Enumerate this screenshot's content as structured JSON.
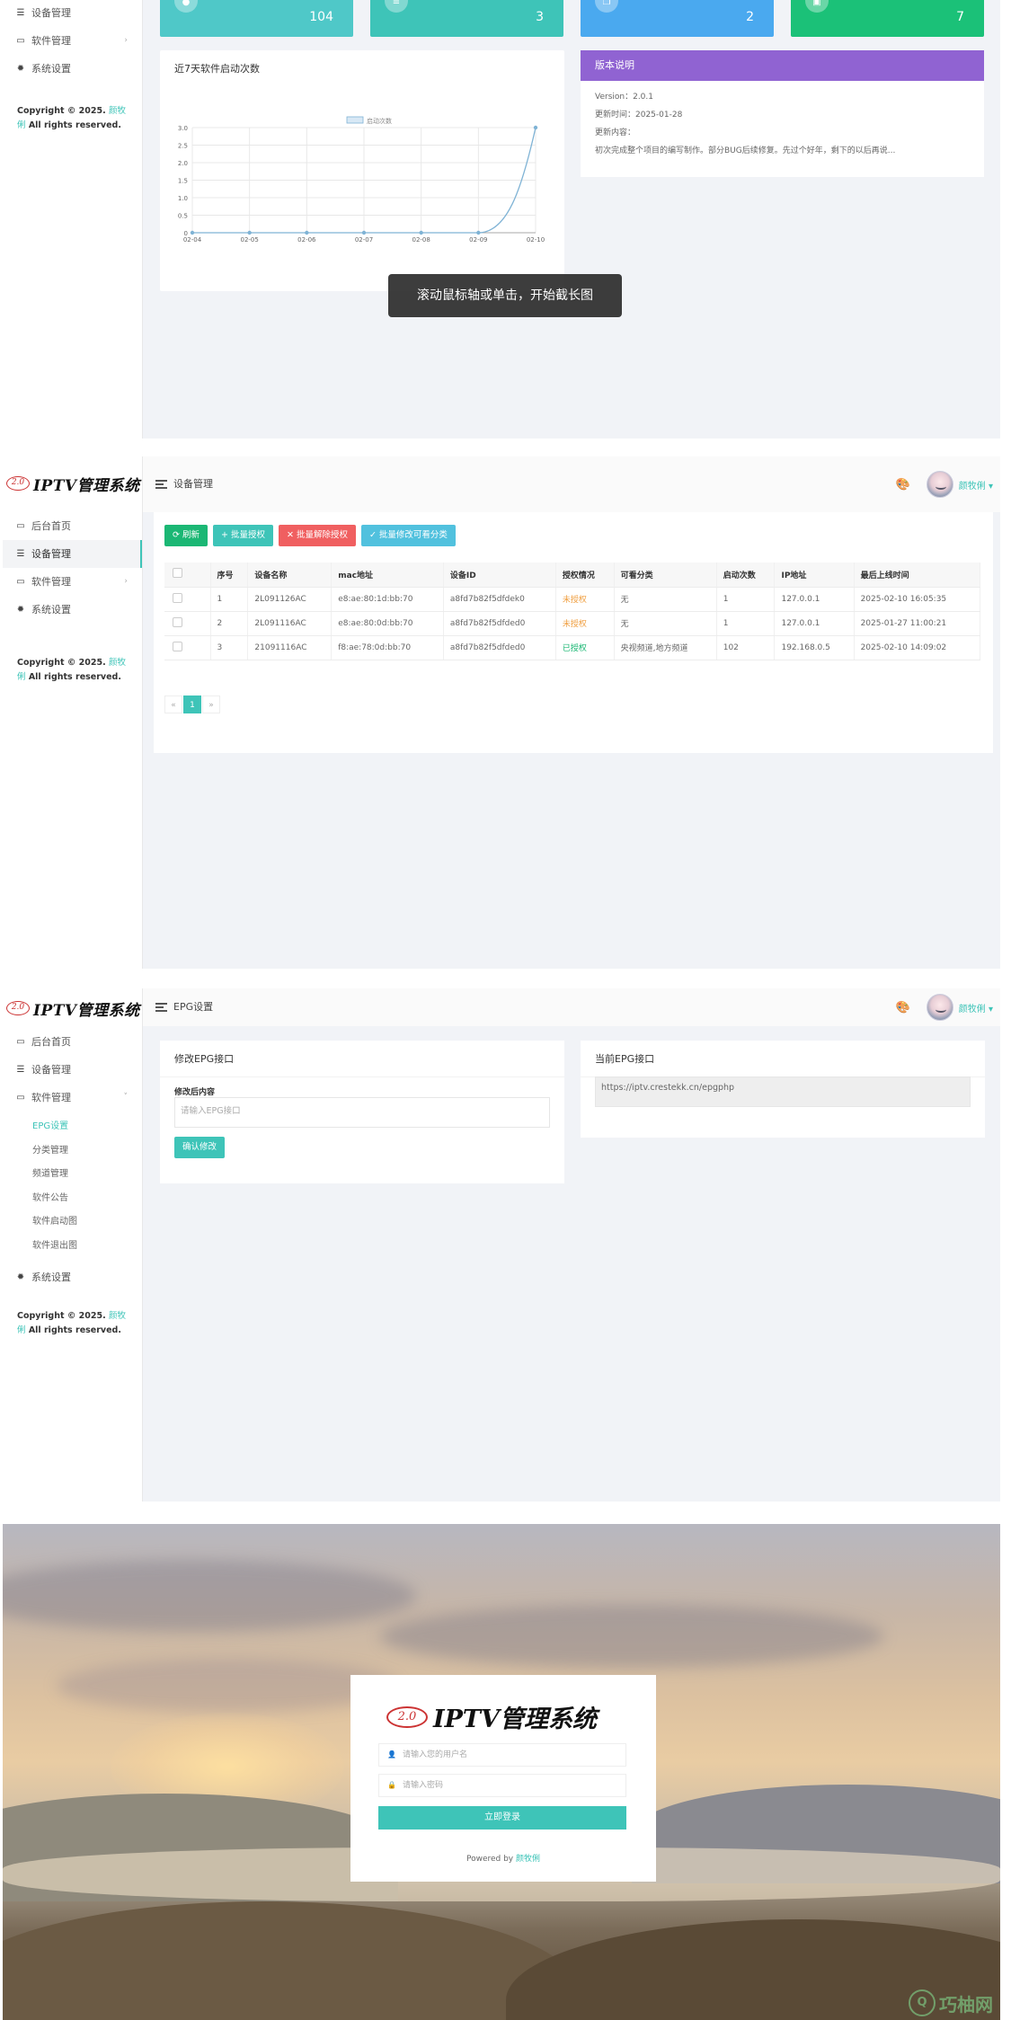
{
  "app": {
    "logo_text": "IPTV管理系统",
    "seal_text": "2.0",
    "copyright_prefix": "Copyright © 2025.",
    "copyright_author": "颜牧俐",
    "copyright_suffix": "All rights reserved.",
    "username": "颜牧俐 ▾"
  },
  "nav": {
    "home": "后台首页",
    "devices": "设备管理",
    "software": "软件管理",
    "system": "系统设置"
  },
  "software_sub": [
    "EPG设置",
    "分类管理",
    "频道管理",
    "软件公告",
    "软件启动图",
    "软件退出图"
  ],
  "stats": [
    {
      "value": "104",
      "color": "#4fc8c8",
      "icon": "user-icon"
    },
    {
      "value": "3",
      "color": "#3ec4b8",
      "icon": "list-icon"
    },
    {
      "value": "2",
      "color": "#4aa9ef",
      "icon": "copy-icon"
    },
    {
      "value": "7",
      "color": "#1bc178",
      "icon": "tv-icon"
    }
  ],
  "chart_card": {
    "title": "近7天软件启动次数"
  },
  "chart_data": {
    "type": "line",
    "title": "",
    "x": [
      "02-04",
      "02-05",
      "02-06",
      "02-07",
      "02-08",
      "02-09",
      "02-10"
    ],
    "series": [
      {
        "name": "启动次数",
        "values": [
          0,
          0,
          0,
          0,
          0,
          0,
          3
        ]
      }
    ],
    "ylim": [
      0,
      3
    ],
    "yticks": [
      "0",
      "0.5",
      "1.0",
      "1.5",
      "2.0",
      "2.5",
      "3.0"
    ],
    "grid": true,
    "legend": "top-center",
    "color": "#7fb3d5"
  },
  "version_card": {
    "title": "版本说明",
    "version": "Version：2.0.1",
    "updated": "更新时间：2025-01-28",
    "content_label": "更新内容：",
    "content": "初次完成整个项目的编写制作。部分BUG后续修复。先过个好年，剩下的以后再说..."
  },
  "tooltip": "滚动鼠标轴或单击，开始截长图",
  "devices_page": {
    "breadcrumb": "设备管理",
    "buttons": {
      "refresh": "⟳ 刷新",
      "batch_auth": "+ 批量授权",
      "batch_unauth": "✕ 批量解除授权",
      "batch_category": "✓ 批量修改可看分类"
    },
    "columns": [
      "序号",
      "设备名称",
      "mac地址",
      "设备ID",
      "授权情况",
      "可看分类",
      "启动次数",
      "IP地址",
      "最后上线时间"
    ],
    "rows": [
      {
        "no": "1",
        "name": "2L091126AC",
        "mac": "e8:ae:80:1d:bb:70",
        "id": "a8fd7b82f5dfdek0",
        "auth": "未授权",
        "auth_state": "warn",
        "cat": "无",
        "count": "1",
        "ip": "127.0.0.1",
        "last": "2025-02-10 16:05:35"
      },
      {
        "no": "2",
        "name": "2L091116AC",
        "mac": "e8:ae:80:0d:bb:70",
        "id": "a8fd7b82f5dfded0",
        "auth": "未授权",
        "auth_state": "warn",
        "cat": "无",
        "count": "1",
        "ip": "127.0.0.1",
        "last": "2025-01-27 11:00:21"
      },
      {
        "no": "3",
        "name": "21091116AC",
        "mac": "f8:ae:78:0d:bb:70",
        "id": "a8fd7b82f5dfded0",
        "auth": "已授权",
        "auth_state": "ok",
        "cat": "央视频道,地方频道",
        "count": "102",
        "ip": "192.168.0.5",
        "last": "2025-02-10 14:09:02"
      }
    ],
    "pager": {
      "prev": "«",
      "current": "1",
      "next": "»"
    }
  },
  "epg_page": {
    "breadcrumb": "EPG设置",
    "edit_title": "修改EPG接口",
    "field_label": "修改后内容",
    "placeholder": "请输入EPG接口",
    "confirm": "确认修改",
    "current_title": "当前EPG接口",
    "current_value": "https://iptv.crestekk.cn/epgphp"
  },
  "login": {
    "user_placeholder": "请输入您的用户名",
    "pass_placeholder": "请输入密码",
    "button": "立即登录",
    "powered_prefix": "Powered by",
    "powered_author": "颜牧俐"
  },
  "watermark": "巧柚网"
}
